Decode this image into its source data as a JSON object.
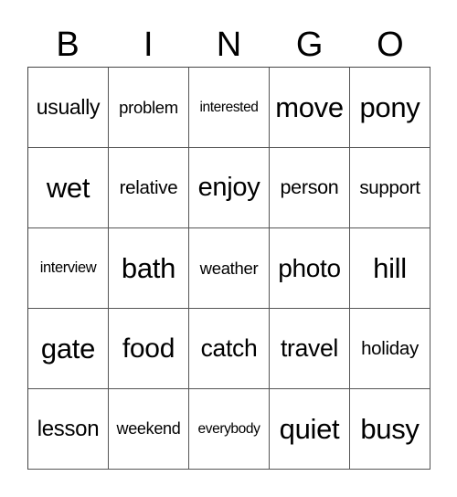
{
  "header": {
    "letters": [
      "B",
      "I",
      "N",
      "G",
      "O"
    ]
  },
  "card": {
    "cells": [
      "usually",
      "problem",
      "interested",
      "move",
      "pony",
      "wet",
      "relative",
      "enjoy",
      "person",
      "support",
      "interview",
      "bath",
      "weather",
      "photo",
      "hill",
      "gate",
      "food",
      "catch",
      "travel",
      "holiday",
      "lesson",
      "weekend",
      "everybody",
      "quiet",
      "busy"
    ]
  },
  "colors": {
    "text": "#000000",
    "grid_line": "#555555",
    "background": "#ffffff"
  }
}
